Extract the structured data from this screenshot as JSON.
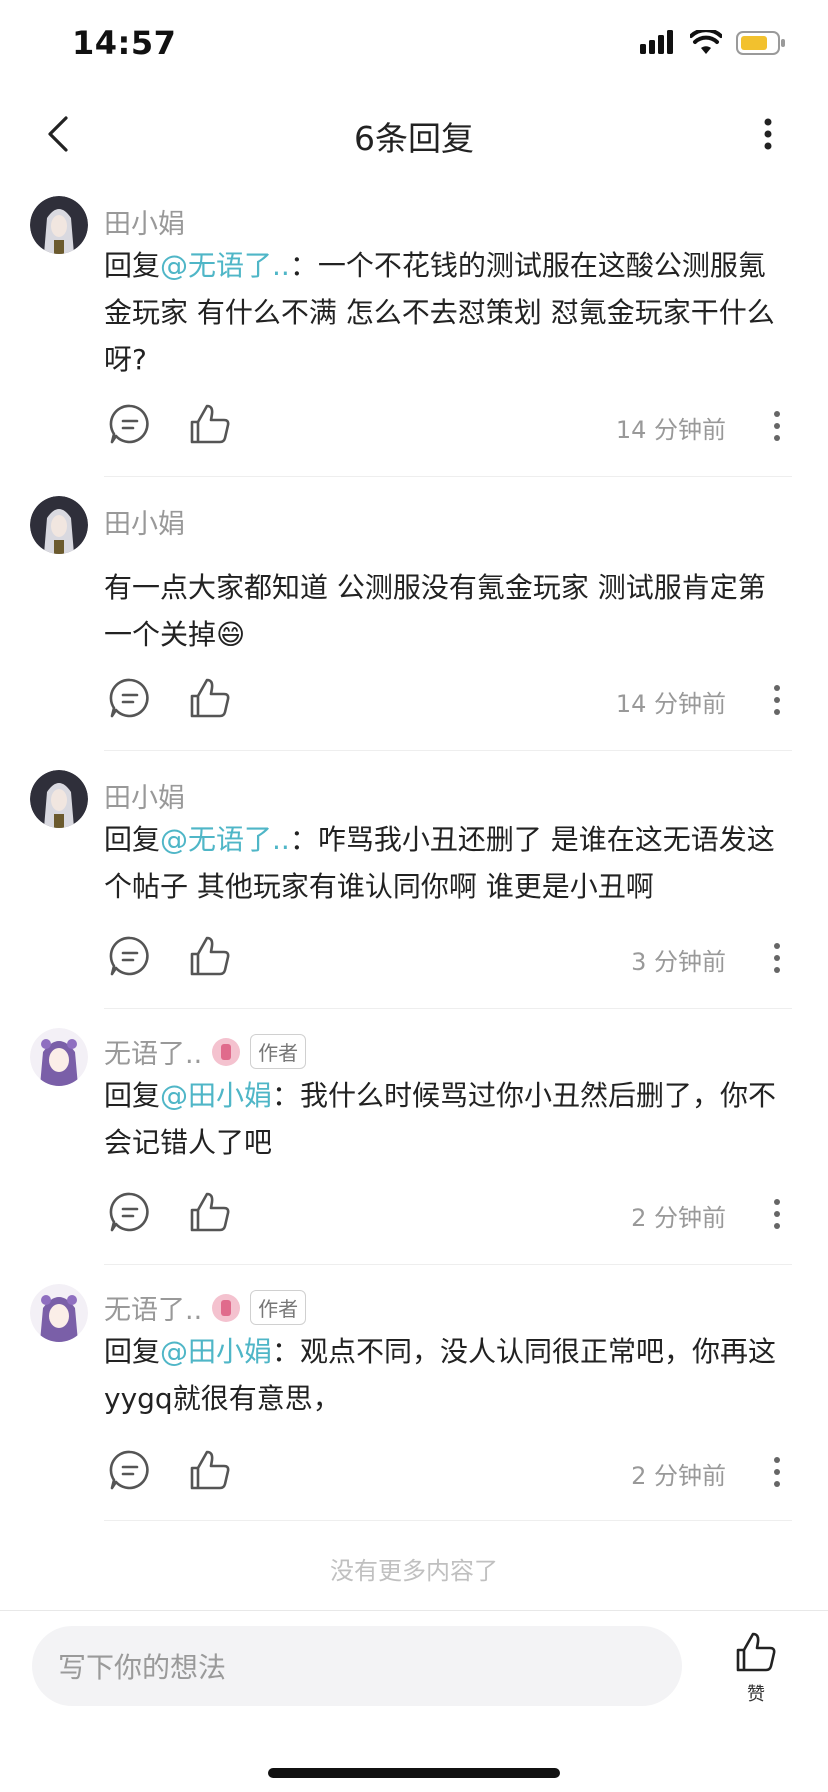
{
  "status_bar": {
    "time": "14:57"
  },
  "header": {
    "title": "6条回复"
  },
  "comments": [
    {
      "author": "田小娟",
      "reply_prefix": "回复",
      "mention": "@无语了..",
      "colon": "：",
      "text": "一个不花钱的测试服在这酸公测服氪金玩家 有什么不满 怎么不去怼策划 怼氪金玩家干什么呀?",
      "time": "14 分钟前"
    },
    {
      "author": "田小娟",
      "text": "有一点大家都知道 公测服没有氪金玩家 测试服肯定第一个关掉😄",
      "time": "14 分钟前"
    },
    {
      "author": "田小娟",
      "reply_prefix": "回复",
      "mention": "@无语了..",
      "colon": "：",
      "text": "咋骂我小丑还删了 是谁在这无语发这个帖子 其他玩家有谁认同你啊 谁更是小丑啊",
      "time": "3 分钟前"
    },
    {
      "author": "无语了..",
      "author_tag": "作者",
      "reply_prefix": "回复",
      "mention": "@田小娟",
      "colon": "：",
      "text": "我什么时候骂过你小丑然后删了，你不会记错人了吧",
      "time": "2 分钟前"
    },
    {
      "author": "无语了..",
      "author_tag": "作者",
      "reply_prefix": "回复",
      "mention": "@田小娟",
      "colon": "：",
      "text": "观点不同，没人认同很正常吧，你再这yygq就很有意思，",
      "time": "2 分钟前"
    }
  ],
  "footer": {
    "no_more": "没有更多内容了",
    "input_placeholder": "写下你的想法",
    "like_label": "赞"
  },
  "colors": {
    "mention": "#4fb6c7",
    "muted": "#999999",
    "battery": "#f2c12e"
  }
}
